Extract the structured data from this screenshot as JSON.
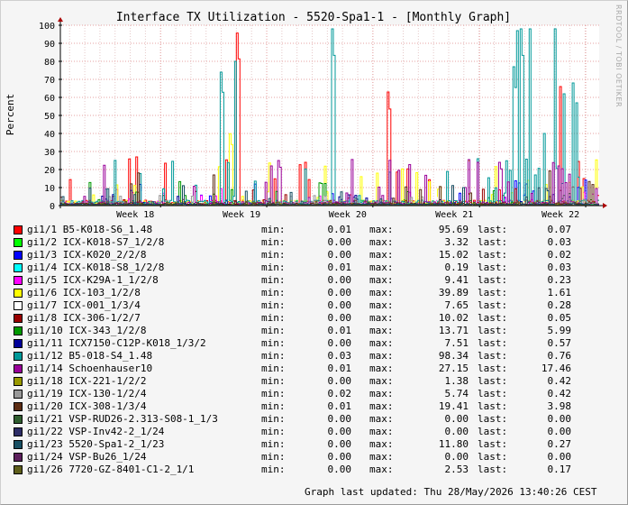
{
  "chart_data": {
    "type": "line",
    "title": "Interface TX Utilization - 5520-Spa1-1 - [Monthly Graph]",
    "ylabel": "Percent",
    "ylim": [
      0,
      100
    ],
    "y_ticks": [
      "0",
      "10",
      "20",
      "30",
      "40",
      "50",
      "60",
      "70",
      "80",
      "90",
      "100"
    ],
    "x_ticks": [
      "Week 18",
      "Week 19",
      "Week 20",
      "Week 21",
      "Week 22"
    ],
    "grid": true,
    "watermark": "RRDTOOL / TOBI OETIKER",
    "series": [
      {
        "name": "gi1/1 B5-K018-S6_1.48",
        "color": "#ff0000",
        "min": "0.01",
        "max": "95.69",
        "last": "0.07"
      },
      {
        "name": "gi1/2 ICX-K018-S7_1/2/8",
        "color": "#00ff00",
        "min": "0.00",
        "max": "3.32",
        "last": "0.03"
      },
      {
        "name": "gi1/3 ICX-K020_2/2/8",
        "color": "#0000ff",
        "min": "0.00",
        "max": "15.02",
        "last": "0.02"
      },
      {
        "name": "gi1/4 ICX-K018-S8_1/2/8",
        "color": "#00ffff",
        "min": "0.01",
        "max": "0.19",
        "last": "0.03"
      },
      {
        "name": "gi1/5 ICX-K29A-1_1/2/8",
        "color": "#ff00ff",
        "min": "0.00",
        "max": "9.41",
        "last": "0.23"
      },
      {
        "name": "gi1/6 ICX-103_1/2/8",
        "color": "#ffff00",
        "min": "0.00",
        "max": "39.89",
        "last": "1.61"
      },
      {
        "name": "gi1/7 ICX-001_1/3/4",
        "color": "#ffffff",
        "min": "0.00",
        "max": "7.65",
        "last": "0.28"
      },
      {
        "name": "gi1/8 ICX-306-1/2/7",
        "color": "#990000",
        "min": "0.00",
        "max": "10.02",
        "last": "0.05"
      },
      {
        "name": "gi1/10 ICX-343_1/2/8",
        "color": "#009900",
        "min": "0.01",
        "max": "13.71",
        "last": "5.99"
      },
      {
        "name": "gi1/11 ICX7150-C12P-K018_1/3/2",
        "color": "#000099",
        "min": "0.00",
        "max": "7.51",
        "last": "0.57"
      },
      {
        "name": "gi1/12 B5-018-S4_1.48",
        "color": "#009999",
        "min": "0.03",
        "max": "98.34",
        "last": "0.76"
      },
      {
        "name": "gi1/14 Schoenhauser10",
        "color": "#990099",
        "min": "0.01",
        "max": "27.15",
        "last": "17.46"
      },
      {
        "name": "gi1/18 ICX-221-1/2/2",
        "color": "#999900",
        "min": "0.00",
        "max": "1.38",
        "last": "0.42"
      },
      {
        "name": "gi1/19 ICX-130-1/2/4",
        "color": "#999999",
        "min": "0.02",
        "max": "5.74",
        "last": "0.42"
      },
      {
        "name": "gi1/20 ICX-308-1/3/4",
        "color": "#5c2c13",
        "min": "0.01",
        "max": "19.41",
        "last": "3.98"
      },
      {
        "name": "gi1/21 VSP-RUD26-2.313-S08-1_1/3",
        "color": "#2f5e2f",
        "min": "0.00",
        "max": "0.00",
        "last": "0.00"
      },
      {
        "name": "gi1/22 VSP-Inv42-2_1/24",
        "color": "#2d2d66",
        "min": "0.00",
        "max": "0.00",
        "last": "0.00"
      },
      {
        "name": "gi1/23 5520-Spa1-2_1/23",
        "color": "#184f63",
        "min": "0.00",
        "max": "11.80",
        "last": "0.27"
      },
      {
        "name": "gi1/24 VSP-Bu26_1/24",
        "color": "#5c1f5c",
        "min": "0.00",
        "max": "0.00",
        "last": "0.00"
      },
      {
        "name": "gi1/26 7720-GZ-8401-C1-2_1/1",
        "color": "#5e5e1a",
        "min": "0.00",
        "max": "2.53",
        "last": "0.17"
      }
    ],
    "spikes": [
      {
        "series": 10,
        "x": 0.296,
        "y": 74
      },
      {
        "series": 10,
        "x": 0.325,
        "y": 80
      },
      {
        "series": 10,
        "x": 0.505,
        "y": 98
      },
      {
        "series": 10,
        "x": 0.842,
        "y": 77
      },
      {
        "series": 10,
        "x": 0.851,
        "y": 97
      },
      {
        "series": 10,
        "x": 0.857,
        "y": 98
      },
      {
        "series": 10,
        "x": 0.874,
        "y": 98
      },
      {
        "series": 10,
        "x": 0.9,
        "y": 40
      },
      {
        "series": 10,
        "x": 0.921,
        "y": 98
      },
      {
        "series": 10,
        "x": 0.953,
        "y": 68
      },
      {
        "series": 10,
        "x": 0.96,
        "y": 57
      },
      {
        "series": 10,
        "x": 0.938,
        "y": 62
      },
      {
        "series": 0,
        "x": 0.327,
        "y": 95.69
      },
      {
        "series": 0,
        "x": 0.608,
        "y": 63
      },
      {
        "series": 0,
        "x": 0.931,
        "y": 66
      },
      {
        "series": 0,
        "x": 0.142,
        "y": 27
      },
      {
        "series": 5,
        "x": 0.315,
        "y": 39.89
      },
      {
        "series": 5,
        "x": 0.59,
        "y": 18
      },
      {
        "series": 11,
        "x": 0.406,
        "y": 25
      },
      {
        "series": 11,
        "x": 0.817,
        "y": 24
      },
      {
        "series": 11,
        "x": 0.777,
        "y": 24
      },
      {
        "series": 11,
        "x": 0.39,
        "y": 22
      },
      {
        "series": 14,
        "x": 0.285,
        "y": 17
      }
    ]
  },
  "footer": {
    "label": "Graph last updated:",
    "timestamp": "Thu 28/May/2026 13:40:26 CEST"
  },
  "labels": {
    "min": "min:",
    "max": "max:",
    "last": "last:"
  }
}
